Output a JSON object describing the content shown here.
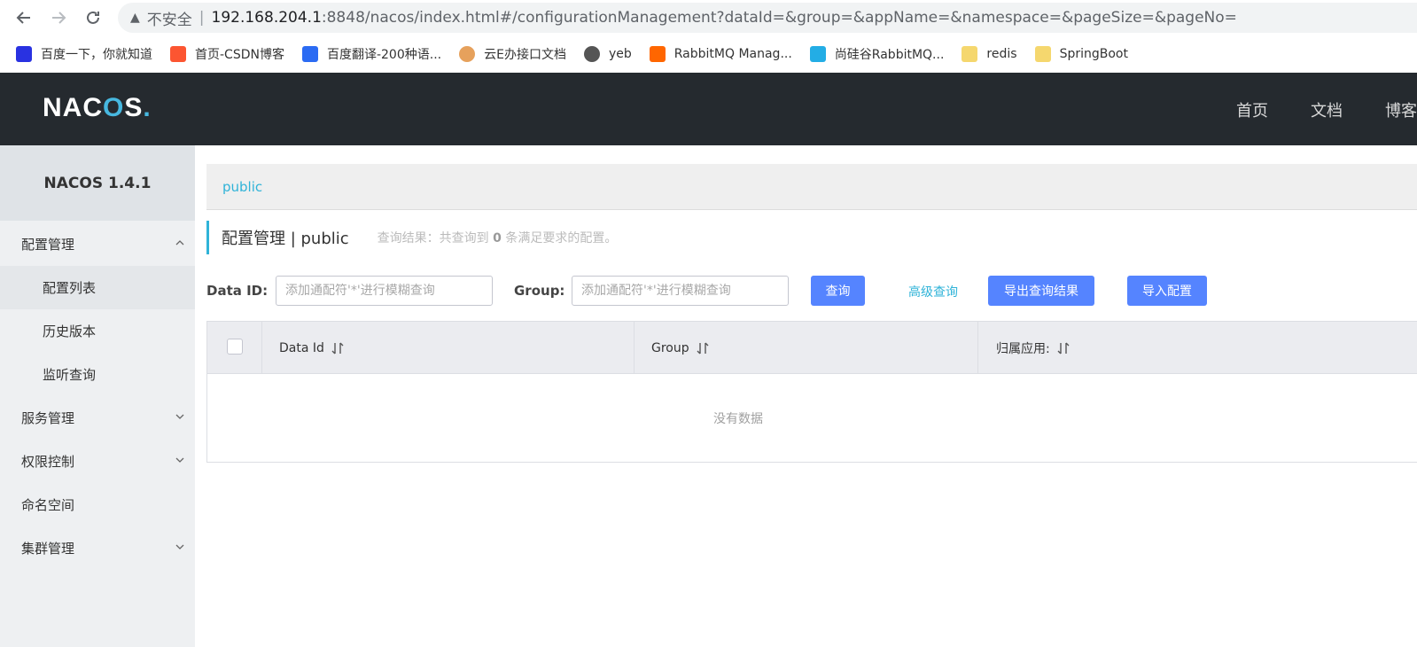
{
  "browser": {
    "insecure_label": "不安全",
    "url_host": "192.168.204.1",
    "url_path": ":8848/nacos/index.html#/configurationManagement?dataId=&group=&appName=&namespace=&pageSize=&pageNo=",
    "bookmarks": [
      {
        "label": "百度一下，你就知道",
        "icon": "baidu-icon",
        "color": "#2932e1"
      },
      {
        "label": "首页-CSDN博客",
        "icon": "csdn-icon",
        "color": "#fc5531"
      },
      {
        "label": "百度翻译-200种语...",
        "icon": "translate-icon",
        "color": "#2b6bf3"
      },
      {
        "label": "云E办接口文档",
        "icon": "doc-icon",
        "color": "#e6a15c"
      },
      {
        "label": "yeb",
        "icon": "globe-icon",
        "color": "#555555"
      },
      {
        "label": "RabbitMQ Manag...",
        "icon": "rabbitmq-icon",
        "color": "#ff6600"
      },
      {
        "label": "尚硅谷RabbitMQ...",
        "icon": "bilibili-icon",
        "color": "#23ade5"
      },
      {
        "label": "redis",
        "icon": "folder-icon",
        "color": "#f5d76e"
      },
      {
        "label": "SpringBoot",
        "icon": "folder-icon",
        "color": "#f5d76e"
      }
    ]
  },
  "header": {
    "logo": "NACOS.",
    "nav": [
      "首页",
      "文档",
      "博客"
    ]
  },
  "sidebar": {
    "version": "NACOS 1.4.1",
    "config_group": "配置管理",
    "config_items": [
      "配置列表",
      "历史版本",
      "监听查询"
    ],
    "service_group": "服务管理",
    "auth_group": "权限控制",
    "namespace_item": "命名空间",
    "cluster_group": "集群管理"
  },
  "main": {
    "namespace_tab": "public",
    "title": "配置管理 | public",
    "summary_prefix": "查询结果：共查询到",
    "summary_count": "0",
    "summary_suffix": "条满足要求的配置。",
    "dataid_label": "Data ID:",
    "dataid_placeholder": "添加通配符'*'进行模糊查询",
    "group_label": "Group:",
    "group_placeholder": "添加通配符'*'进行模糊查询",
    "query_button": "查询",
    "advanced_query": "高级查询",
    "export_button": "导出查询结果",
    "import_button": "导入配置",
    "columns": [
      "Data Id",
      "Group",
      "归属应用:"
    ],
    "empty_text": "没有数据"
  },
  "colors": {
    "header_bg": "#252a2f",
    "accent": "#2fb3d8",
    "primary_button": "#5584ff"
  }
}
